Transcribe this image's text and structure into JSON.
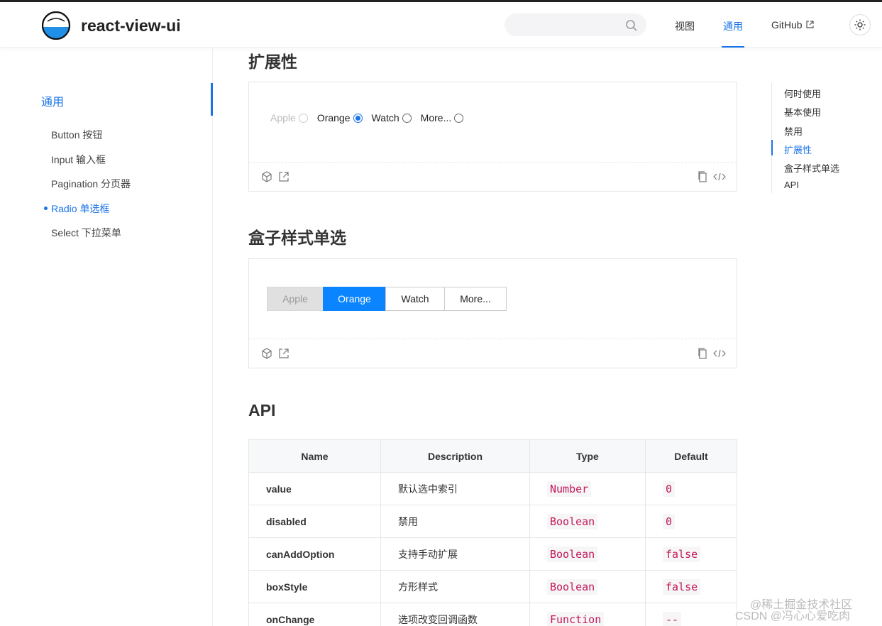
{
  "header": {
    "brand": "react-view-ui",
    "search_placeholder": "",
    "nav": [
      {
        "label": "视图",
        "active": false
      },
      {
        "label": "通用",
        "active": true
      },
      {
        "label": "GitHub",
        "active": false
      }
    ]
  },
  "sidebar": {
    "group": "通用",
    "items": [
      {
        "label": "Button 按钮",
        "active": false
      },
      {
        "label": "Input 输入框",
        "active": false
      },
      {
        "label": "Pagination 分页器",
        "active": false
      },
      {
        "label": "Radio 单选框",
        "active": true
      },
      {
        "label": "Select 下拉菜单",
        "active": false
      }
    ]
  },
  "sections": {
    "extensibility": {
      "title": "扩展性",
      "options": [
        {
          "label": "Apple",
          "state": "disabled"
        },
        {
          "label": "Orange",
          "state": "checked"
        },
        {
          "label": "Watch",
          "state": "normal"
        },
        {
          "label": "More...",
          "state": "normal"
        }
      ]
    },
    "box_style": {
      "title": "盒子样式单选",
      "options": [
        {
          "label": "Apple",
          "state": "disabled"
        },
        {
          "label": "Orange",
          "state": "checked"
        },
        {
          "label": "Watch",
          "state": "normal"
        },
        {
          "label": "More...",
          "state": "normal"
        }
      ]
    },
    "api": {
      "title": "API",
      "headers": [
        "Name",
        "Description",
        "Type",
        "Default"
      ],
      "rows": [
        [
          "value",
          "默认选中索引",
          "Number",
          "0"
        ],
        [
          "disabled",
          "禁用",
          "Boolean",
          "0"
        ],
        [
          "canAddOption",
          "支持手动扩展",
          "Boolean",
          "false"
        ],
        [
          "boxStyle",
          "方形样式",
          "Boolean",
          "false"
        ],
        [
          "onChange",
          "选项改变回调函数",
          "Function",
          "--"
        ]
      ]
    }
  },
  "toc": {
    "items": [
      "何时使用",
      "基本使用",
      "禁用",
      "扩展性",
      "盒子样式单选",
      "API"
    ],
    "active_index": 3
  },
  "watermark": {
    "line1": "@稀土掘金技术社区",
    "line2": "CSDN @冯心心爱吃肉"
  },
  "colors": {
    "accent": "#1a73e8",
    "checked_box": "#0a84ff",
    "code_text": "#c2185b"
  }
}
